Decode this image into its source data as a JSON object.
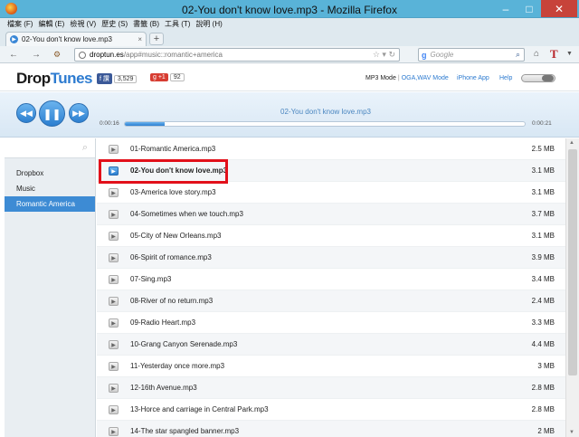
{
  "window": {
    "title": "02-You don't know love.mp3 - Mozilla Firefox",
    "min": "–",
    "max": "□",
    "close": "✕"
  },
  "menubar": [
    "檔案 (F)",
    "編輯 (E)",
    "檢視 (V)",
    "歷史 (S)",
    "書籤 (B)",
    "工具 (T)",
    "說明 (H)"
  ],
  "tab": {
    "label": "02-You don't know love.mp3",
    "close": "×",
    "new": "+"
  },
  "nav": {
    "back": "←",
    "forward": "→",
    "url_host": "droptun.es",
    "url_path": "/app#music::romantic+america",
    "url_icons": "☆ ▾ ↻",
    "search_engine": "g",
    "search_placeholder": "Google",
    "search_icon": "⌕",
    "home": "⌂",
    "t_icon": "T",
    "menu_arrow": "▼"
  },
  "header": {
    "brand_a": "Drop",
    "brand_b": "Tunes",
    "fb_label": "f 讚",
    "fb_count": "3,529",
    "gp_label": "g +1",
    "gp_count": "92",
    "mode_active": "MP3 Mode",
    "mode_sep": "|",
    "mode_other": "OGA,WAV Mode",
    "iphone": "iPhone App",
    "help": "Help"
  },
  "player": {
    "prev": "◀◀",
    "play": "❚❚",
    "next": "▶▶",
    "now_playing": "02-You don't know love.mp3",
    "elapsed": "0:00:16",
    "total": "0:00:21",
    "progress": 0.1
  },
  "sidebar": {
    "search_icon": "⌕",
    "items": [
      {
        "label": "Dropbox",
        "selected": false
      },
      {
        "label": "Music",
        "selected": false
      },
      {
        "label": "Romantic America",
        "selected": true
      }
    ]
  },
  "tracks": [
    {
      "name": "01-Romantic America.mp3",
      "size": "2.5 MB",
      "current": false
    },
    {
      "name": "02-You don't know love.mp3",
      "size": "3.1 MB",
      "current": true
    },
    {
      "name": "03-America love story.mp3",
      "size": "3.1 MB",
      "current": false
    },
    {
      "name": "04-Sometimes when we touch.mp3",
      "size": "3.7 MB",
      "current": false
    },
    {
      "name": "05-City of New Orleans.mp3",
      "size": "3.1 MB",
      "current": false
    },
    {
      "name": "06-Spirit of romance.mp3",
      "size": "3.9 MB",
      "current": false
    },
    {
      "name": "07-Sing.mp3",
      "size": "3.4 MB",
      "current": false
    },
    {
      "name": "08-River of no return.mp3",
      "size": "2.4 MB",
      "current": false
    },
    {
      "name": "09-Radio Heart.mp3",
      "size": "3.3 MB",
      "current": false
    },
    {
      "name": "10-Grang Canyon Serenade.mp3",
      "size": "4.4 MB",
      "current": false
    },
    {
      "name": "11-Yesterday once more.mp3",
      "size": "3 MB",
      "current": false
    },
    {
      "name": "12-16th Avenue.mp3",
      "size": "2.8 MB",
      "current": false
    },
    {
      "name": "13-Horce and carriage in Central Park.mp3",
      "size": "2.8 MB",
      "current": false
    },
    {
      "name": "14-The star spangled banner.mp3",
      "size": "2 MB",
      "current": false
    }
  ],
  "track_play_icon": "▶",
  "scroll": {
    "up": "▲",
    "down": "▼"
  },
  "colors": {
    "accent": "#2c7fd0",
    "selected_bg": "#3d8bd4",
    "highlight": "#e2101a",
    "titlebar": "#59b3d8"
  }
}
